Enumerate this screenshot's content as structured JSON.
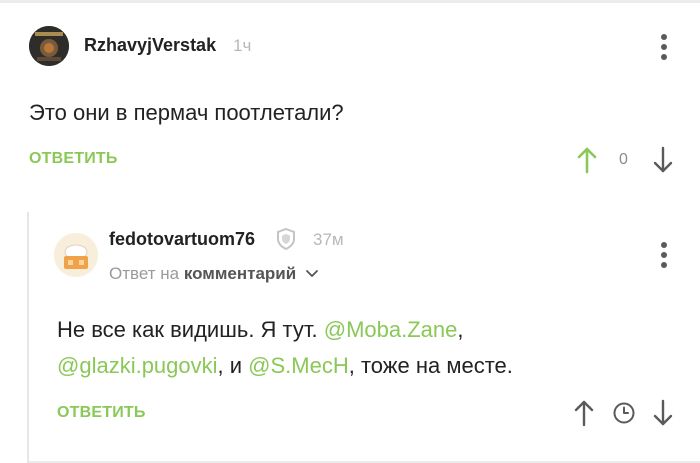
{
  "comment1": {
    "username": "RzhavyjVerstak",
    "time": "1ч",
    "text": "Это они в пермач поотлетали?",
    "reply_label": "ОТВЕТИТЬ",
    "rating": "0"
  },
  "comment2": {
    "username": "fedotovartuom76",
    "time": "37м",
    "reply_to_prefix": "Ответ на",
    "reply_to_link": "комментарий",
    "text_part1": "Не все как видишь. Я тут. ",
    "mention1": "@Moba.Zane",
    "text_part2": ",",
    "mention2": "@glazki.pugovki",
    "text_part3": ", и ",
    "mention3": "@S.MecH",
    "text_part4": ", тоже на месте.",
    "reply_label": "ОТВЕТИТЬ"
  },
  "colors": {
    "accent": "#8ac858",
    "muted": "#b8b8b8",
    "icon": "#5a5a5a"
  }
}
